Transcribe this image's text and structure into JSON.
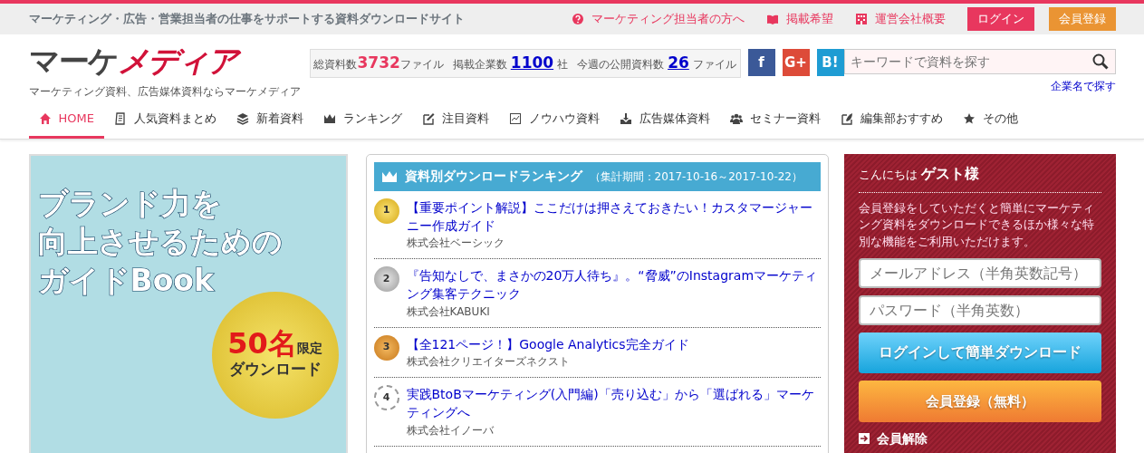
{
  "top_bar": {
    "tagline": "マーケティング・広告・営業担当者の仕事をサポートする資料ダウンロードサイト",
    "links": [
      {
        "label": "マーケティング担当者の方へ",
        "kind": "question"
      },
      {
        "label": "掲載希望",
        "kind": "book"
      },
      {
        "label": "運営会社概要",
        "kind": "building"
      }
    ],
    "login_button": "ログイン",
    "register_button": "会員登録"
  },
  "header": {
    "logo_dark": "マーケ",
    "logo_accent": "メディア",
    "logo_subtitle": "マーケティング資料、広告媒体資料ならマーケメディア",
    "stats": [
      {
        "label": "総資料数",
        "value": "3732",
        "unit": "ファイル",
        "kind": "plain"
      },
      {
        "label": "掲載企業数",
        "value": "1100",
        "unit": "社",
        "kind": "link"
      },
      {
        "label": "今週の公開資料数",
        "value": "26",
        "unit": "ファイル",
        "kind": "link"
      }
    ],
    "social": [
      {
        "label": "f",
        "kind": "facebook"
      },
      {
        "label": "G+",
        "kind": "google"
      },
      {
        "label": "B!",
        "kind": "hatena"
      }
    ],
    "search": {
      "placeholder": "キーワードで資料を探す"
    },
    "company_search_link": "企業名で探す"
  },
  "nav": [
    {
      "label": "HOME",
      "kind": "home",
      "selected": true
    },
    {
      "label": "人気資料まとめ",
      "kind": "document",
      "selected": false
    },
    {
      "label": "新着資料",
      "kind": "layers",
      "selected": false
    },
    {
      "label": "ランキング",
      "kind": "crown",
      "selected": false
    },
    {
      "label": "注目資料",
      "kind": "edit",
      "selected": false
    },
    {
      "label": "ノウハウ資料",
      "kind": "chart",
      "selected": false
    },
    {
      "label": "広告媒体資料",
      "kind": "download",
      "selected": false
    },
    {
      "label": "セミナー資料",
      "kind": "people",
      "selected": false
    },
    {
      "label": "編集部おすすめ",
      "kind": "pen",
      "selected": false
    },
    {
      "label": "その他",
      "kind": "star",
      "selected": false
    }
  ],
  "banner": {
    "headline": [
      "ブランド力を",
      "向上させるための",
      "ガイドBook"
    ],
    "count": "50名",
    "limit": "限定",
    "action": "ダウンロード"
  },
  "ranking": {
    "title": "資料別ダウンロードランキング",
    "period": "（集計期間：2017-10-16～2017-10-22）",
    "items": [
      {
        "rank": "1",
        "kind": "gold",
        "title": "【重要ポイント解説】ここだけは押さえておきたい！カスタマージャーニー作成ガイド",
        "company": "株式会社ベーシック"
      },
      {
        "rank": "2",
        "kind": "silver",
        "title": "『告知なしで、まさかの20万人待ち』。“脅威”のInstagramマーケティング集客テクニック",
        "company": "株式会社KABUKI"
      },
      {
        "rank": "3",
        "kind": "bronze",
        "title": "【全121ページ！】Google Analytics完全ガイド",
        "company": "株式会社クリエイターズネクスト"
      },
      {
        "rank": "4",
        "kind": "plain",
        "title": "実践BtoBマーケティング(入門編)「売り込む」から「選ばれる」マーケティングへ",
        "company": "株式会社イノーバ"
      }
    ]
  },
  "member_panel": {
    "greeting": "こんにちは",
    "name": "ゲスト様",
    "description": "会員登録をしていただくと簡単にマーケティング資料をダウンロードできるほか様々な特別な機能をご利用いただけます。",
    "email": {
      "placeholder": "メールアドレス（半角英数記号）"
    },
    "password": {
      "placeholder": "パスワード（半角英数）"
    },
    "login_button": "ログインして簡単ダウンロード",
    "register_button": "会員登録（無料）",
    "unsubscribe_link": "会員解除"
  }
}
